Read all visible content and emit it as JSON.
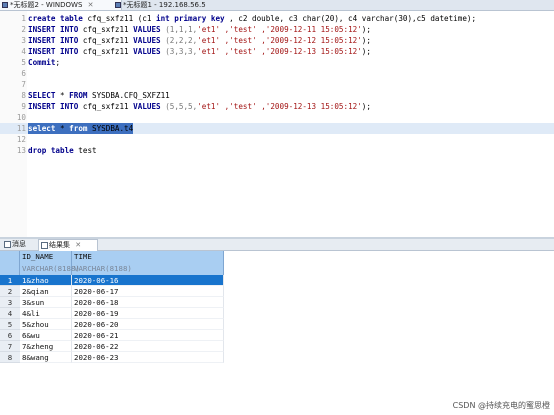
{
  "tabs": [
    {
      "label": "*无标题2 - WINDOWS",
      "close": "✕"
    },
    {
      "label": "*无标题1 - 192.168.56.5",
      "close": ""
    }
  ],
  "editor": {
    "lines": [
      {
        "n": "1",
        "tokens": [
          [
            "kw",
            "create table "
          ],
          [
            "id",
            "cfq_sxfz11 (c1 "
          ],
          [
            "kw",
            "int primary key"
          ],
          [
            "id",
            " , c2 double, c3 char(20), c4 varchar(30),c5 datetime);"
          ]
        ]
      },
      {
        "n": "2",
        "tokens": [
          [
            "kw",
            "INSERT INTO "
          ],
          [
            "id",
            "cfq_sxfz11 "
          ],
          [
            "kw",
            "VALUES "
          ],
          [
            "num",
            "(1,1,1,"
          ],
          [
            "str",
            "'et1' ,'test' ,'2009-12-11 15:05:12'"
          ],
          [
            "id",
            ");"
          ]
        ]
      },
      {
        "n": "3",
        "tokens": [
          [
            "kw",
            "INSERT INTO "
          ],
          [
            "id",
            "cfq_sxfz11 "
          ],
          [
            "kw",
            "VALUES "
          ],
          [
            "num",
            "(2,2,2,"
          ],
          [
            "str",
            "'et1' ,'test' ,'2009-12-12 15:05:12'"
          ],
          [
            "id",
            ");"
          ]
        ]
      },
      {
        "n": "4",
        "tokens": [
          [
            "kw",
            "INSERT INTO "
          ],
          [
            "id",
            "cfq_sxfz11 "
          ],
          [
            "kw",
            "VALUES "
          ],
          [
            "num",
            "(3,3,3,"
          ],
          [
            "str",
            "'et1' ,'test' ,'2009-12-13 15:05:12'"
          ],
          [
            "id",
            ");"
          ]
        ]
      },
      {
        "n": "5",
        "tokens": [
          [
            "kw",
            "Commit"
          ],
          [
            "id",
            ";"
          ]
        ]
      },
      {
        "n": "6",
        "tokens": []
      },
      {
        "n": "7",
        "tokens": []
      },
      {
        "n": "8",
        "tokens": [
          [
            "kw",
            "SELECT "
          ],
          [
            "id",
            "* "
          ],
          [
            "kw",
            "FROM "
          ],
          [
            "id",
            "SYSDBA.CFQ_SXFZ11"
          ]
        ]
      },
      {
        "n": "9",
        "tokens": [
          [
            "kw",
            "INSERT INTO "
          ],
          [
            "id",
            "cfq_sxfz11 "
          ],
          [
            "kw",
            "VALUES "
          ],
          [
            "num",
            "(5,5,5,"
          ],
          [
            "str",
            "'et1' ,'test' ,'2009-12-13 15:05:12'"
          ],
          [
            "id",
            ");"
          ]
        ]
      },
      {
        "n": "10",
        "tokens": []
      },
      {
        "n": "11",
        "tokens": [
          [
            "kw",
            "select "
          ],
          [
            "id",
            "* "
          ],
          [
            "kw",
            "from "
          ],
          [
            "id",
            "SYSDBA.t4"
          ]
        ],
        "selected": true
      },
      {
        "n": "12",
        "tokens": []
      },
      {
        "n": "13",
        "tokens": [
          [
            "kw",
            "drop table "
          ],
          [
            "id",
            "test"
          ]
        ]
      }
    ]
  },
  "result_tabs": [
    {
      "label": "消息"
    },
    {
      "label": "结果集",
      "close": "✕"
    }
  ],
  "grid": {
    "columns": [
      {
        "name": "ID_NAME",
        "type": "VARCHAR(8188)"
      },
      {
        "name": "TIME",
        "type": "VARCHAR(8188)"
      }
    ],
    "rows": [
      {
        "n": "1",
        "cells": [
          "1&zhao",
          "2020-06-16"
        ]
      },
      {
        "n": "2",
        "cells": [
          "2&qian",
          "2020-06-17"
        ]
      },
      {
        "n": "3",
        "cells": [
          "3&sun",
          "2020-06-18"
        ]
      },
      {
        "n": "4",
        "cells": [
          "4&li",
          "2020-06-19"
        ]
      },
      {
        "n": "5",
        "cells": [
          "5&zhou",
          "2020-06-20"
        ]
      },
      {
        "n": "6",
        "cells": [
          "6&wu",
          "2020-06-21"
        ]
      },
      {
        "n": "7",
        "cells": [
          "7&zheng",
          "2020-06-22"
        ]
      },
      {
        "n": "8",
        "cells": [
          "8&wang",
          "2020-06-23"
        ]
      }
    ],
    "selected_row": 0
  },
  "watermark": "CSDN @持续充电的蜜思橙"
}
